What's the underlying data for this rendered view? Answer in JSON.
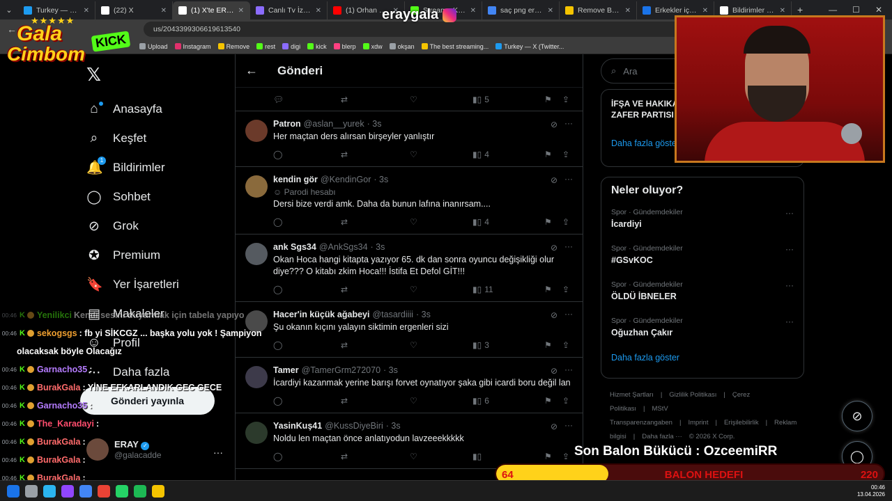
{
  "browser": {
    "tabs": [
      {
        "title": "Turkey — X (Twitter)",
        "color": "#1d9bf0",
        "active": false
      },
      {
        "title": "(22) X",
        "color": "#ffffff",
        "active": false
      },
      {
        "title": "(1) X'te ERAY: \"DE",
        "color": "#ffffff",
        "active": true
      },
      {
        "title": "Canlı Tv İzle - Digi",
        "color": "#8b6cff",
        "active": false
      },
      {
        "title": "(1) Orhan Ger",
        "color": "#ff0000",
        "active": false
      },
      {
        "title": "Stream - Kick",
        "color": "#53fc18",
        "active": false
      },
      {
        "title": "saç png erkek - G",
        "color": "#4285f4",
        "active": false
      },
      {
        "title": "Remove Backgrou",
        "color": "#f5c400",
        "active": false
      },
      {
        "title": "Erkekler için PNG",
        "color": "#1a73e8",
        "active": false
      },
      {
        "title": "Bildirimler / X",
        "color": "#ffffff",
        "active": false
      }
    ],
    "url": "us/2043399306619613540",
    "bookmarks": [
      {
        "label": "Upload",
        "color": "#9aa0a6"
      },
      {
        "label": "Instagram",
        "color": "#e1306c"
      },
      {
        "label": "Remove",
        "color": "#f5c400"
      },
      {
        "label": "rest",
        "color": "#53fc18"
      },
      {
        "label": "digi",
        "color": "#8b6cff"
      },
      {
        "label": "kick",
        "color": "#53fc18"
      },
      {
        "label": "blerp",
        "color": "#ff4081"
      },
      {
        "label": "xdw",
        "color": "#53fc18"
      },
      {
        "label": "okşan",
        "color": "#9aa0a6"
      },
      {
        "label": "The best streaming...",
        "color": "#f5c400"
      },
      {
        "label": "Turkey — X (Twitter...",
        "color": "#1d9bf0"
      }
    ]
  },
  "stream": {
    "channel": "eraygala",
    "logo_line1": "Gala",
    "logo_line2": "Cimbom",
    "logo_kick": "KICK",
    "balon_label": "Son Balon Bükücü : OzceemiRR",
    "balon_start": "64",
    "balon_title": "BALON HEDEFI",
    "balon_end": "220",
    "balon_progress": 0.29
  },
  "chat": [
    {
      "time": "00:46",
      "user": "Yenilikci",
      "msg": "Kendi sesini duyurmak için tabela yapıyo",
      "color": "#53fc18",
      "dim": true
    },
    {
      "time": "00:46",
      "user": "sekogsgs",
      "msg": ": fb yi SİKCGZ ... başka yolu yok ! Şampiyon",
      "color": "#f0a030",
      "dim": false
    },
    {
      "time": "",
      "user": "",
      "msg": "olacaksak böyle Olacağız",
      "color": "#fff",
      "dim": false
    },
    {
      "time": "00:46",
      "user": "Garnacho35",
      "msg": ":",
      "color": "#b57cff",
      "dim": false
    },
    {
      "time": "00:46",
      "user": "BurakGala",
      "msg": ": YİNE EFKARLANDIK GEC GECE",
      "color": "#ff6b6b",
      "dim": false
    },
    {
      "time": "00:46",
      "user": "Garnacho35",
      "msg": ":",
      "color": "#b57cff",
      "dim": false
    },
    {
      "time": "00:46",
      "user": "The_Karadayi",
      "msg": ":",
      "color": "#ff4d6d",
      "dim": false
    },
    {
      "time": "00:46",
      "user": "BurakGala",
      "msg": ":",
      "color": "#ff6b6b",
      "dim": false
    },
    {
      "time": "00:46",
      "user": "BurakGala",
      "msg": ":",
      "color": "#ff6b6b",
      "dim": false
    },
    {
      "time": "00:46",
      "user": "BurakGala",
      "msg": ":",
      "color": "#ff6b6b",
      "dim": false
    },
    {
      "time": "00:46",
      "user": "BurakGala",
      "msg": ":",
      "color": "#ff6b6b",
      "dim": false
    }
  ],
  "nav": {
    "items": [
      {
        "label": "Anasayfa",
        "icon": "⌂",
        "name": "home-icon"
      },
      {
        "label": "Keşfet",
        "icon": "⌕",
        "name": "search-icon"
      },
      {
        "label": "Bildirimler",
        "icon": "🔔",
        "name": "bell-icon"
      },
      {
        "label": "Sohbet",
        "icon": "◯",
        "name": "chat-icon"
      },
      {
        "label": "Grok",
        "icon": "⊘",
        "name": "grok-icon"
      },
      {
        "label": "Premium",
        "icon": "✪",
        "name": "premium-icon"
      },
      {
        "label": "Yer İşaretleri",
        "icon": "🔖",
        "name": "bookmark-icon"
      },
      {
        "label": "Makaleler",
        "icon": "▤",
        "name": "articles-icon"
      },
      {
        "label": "Profil",
        "icon": "☺",
        "name": "profile-icon"
      },
      {
        "label": "Daha fazla",
        "icon": "⋯",
        "name": "more-icon"
      }
    ],
    "notif_count": "1",
    "post_button": "Gönderi yayınla",
    "profile_name": "ERAY",
    "profile_handle": "@galacadde"
  },
  "timeline": {
    "header_title": "Gönderi",
    "top_views": "5",
    "tweets": [
      {
        "name": "Patron",
        "handle": "@aslan__yurek",
        "time": "· 3s",
        "parody": "",
        "text": "Her maçtan ders alırsan birşeyler yanlıştır",
        "views": "4",
        "avatar": "#6b3a2a"
      },
      {
        "name": "kendin gör",
        "handle": "@KendinGor",
        "time": "· 3s",
        "parody": "Parodi hesabı",
        "text": "Dersi bize verdi amk. Daha da bunun lafına inanırsam....",
        "views": "4",
        "avatar": "#8a6a3c"
      },
      {
        "name": "ank Sgs34",
        "handle": "@AnkSgs34",
        "time": "· 3s",
        "parody": "",
        "text": "Okan Hoca hangi kitapta yazıyor 65.  dk dan sonra oyuncu değişikliği olur diye??? O kitabı zkim Hoca!!! İstifa Et Defol GİT!!!",
        "views": "11",
        "avatar": "#555a60"
      },
      {
        "name": "Hacer'in küçük ağabeyi",
        "handle": "@tasardiiii",
        "time": "· 3s",
        "parody": "",
        "text": "Şu okanın kıçını yalayın siktimin ergenleri sizi",
        "views": "3",
        "avatar": "#4a4a4a"
      },
      {
        "name": "Tamer",
        "handle": "@TamerGrm272070",
        "time": "· 3s",
        "parody": "",
        "text": "İcardiyi kazanmak yerine barışı forvet oynatıyor şaka gibi icardi boru değil lan",
        "views": "6",
        "avatar": "#3d3a4a"
      },
      {
        "name": "YasinKuş41",
        "handle": "@KussDiyeBiri",
        "time": "· 3s",
        "parody": "",
        "text": "Noldu len maçtan önce anlatıyodun lavzeeekkkkk",
        "views": "",
        "avatar": "#2c3a2c"
      }
    ]
  },
  "sidebar_right": {
    "search_placeholder": "Ara",
    "box1_line1": "İFŞA VE HAKIKA",
    "box1_line2": "ZAFER PARTISI",
    "box1_more": "Daha fazla göster",
    "trends_title": "Neler oluyor?",
    "trends": [
      {
        "category": "Spor · Gündemdekiler",
        "name": "İcardiyi"
      },
      {
        "category": "Spor · Gündemdekiler",
        "name": "#GSvKOC"
      },
      {
        "category": "Spor · Gündemdekiler",
        "name": "ÖLDÜ İBNELER"
      },
      {
        "category": "Spor · Gündemdekiler",
        "name": "Oğuzhan Çakır"
      }
    ],
    "trends_more": "Daha fazla göster",
    "footer": [
      "Hizmet Şartları",
      "|",
      "Gizlilik Politikası",
      "|",
      "Çerez Politikası",
      "|",
      "MStV Transparenzangaben",
      "|",
      "Imprint",
      "|",
      "Erişilebilirlik",
      "|",
      "Reklam bilgisi",
      "|",
      "Daha fazla ···",
      "© 2026 X Corp."
    ]
  },
  "taskbar": {
    "time": "00:46",
    "date": "13.04.2026"
  }
}
